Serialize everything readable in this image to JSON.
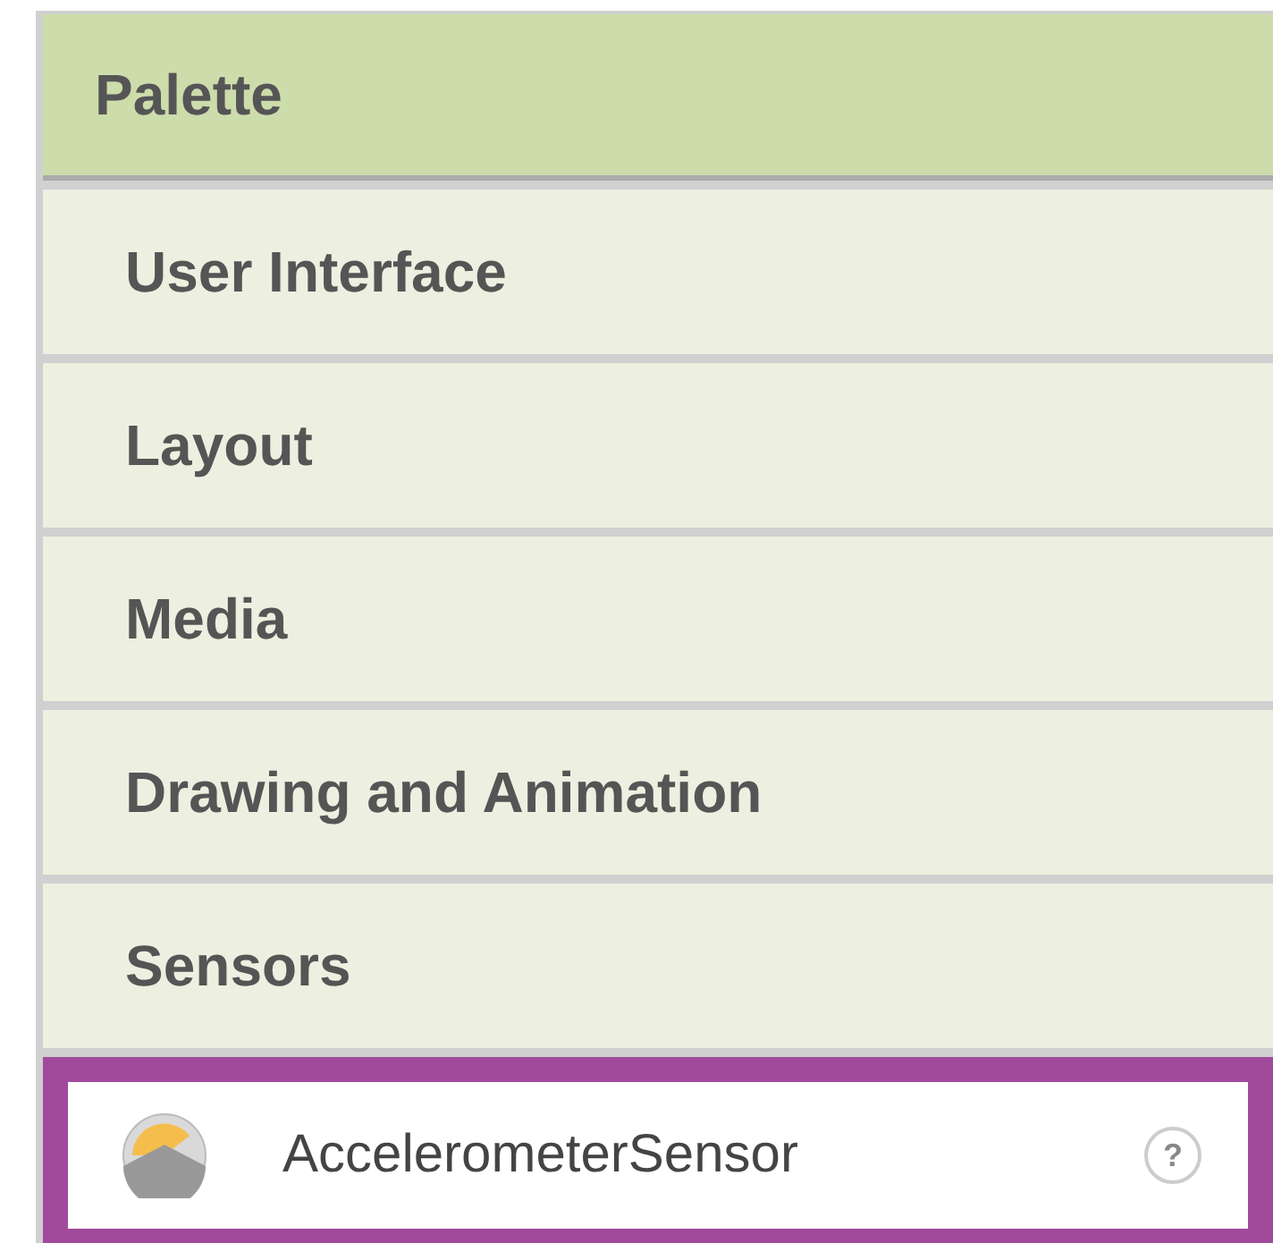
{
  "palette": {
    "title": "Palette",
    "categories": [
      {
        "label": "User Interface"
      },
      {
        "label": "Layout"
      },
      {
        "label": "Media"
      },
      {
        "label": "Drawing and Animation"
      },
      {
        "label": "Sensors"
      }
    ],
    "components": [
      {
        "label": "AccelerometerSensor",
        "help": "?",
        "selected": true
      }
    ]
  }
}
